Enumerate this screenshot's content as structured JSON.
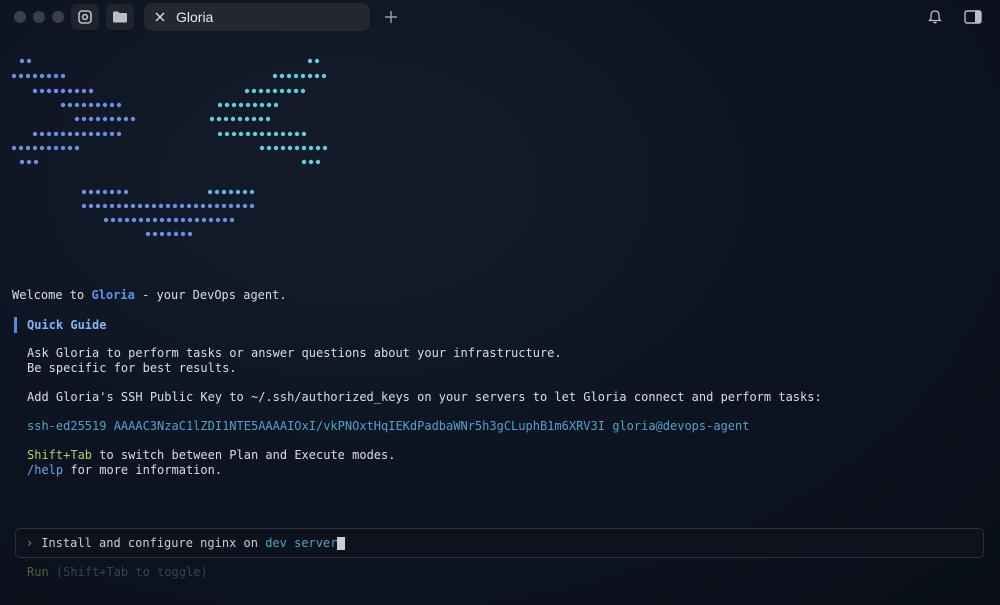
{
  "window": {
    "tab_title": "Gloria",
    "icons": [
      "gloria-logo-icon",
      "folder-icon",
      "close-icon",
      "plus-icon",
      "bell-icon",
      "sidebar-icon"
    ]
  },
  "welcome": {
    "prefix": "Welcome to ",
    "name": "Gloria",
    "suffix": " - your DevOps agent."
  },
  "guide": {
    "title": "Quick Guide",
    "line1": "Ask Gloria to perform tasks or answer questions about your infrastructure.",
    "line2": "Be specific for best results.",
    "line3": "Add Gloria's SSH Public Key to ~/.ssh/authorized_keys on your servers to let Gloria connect and perform tasks:",
    "ssh_key": "ssh-ed25519 AAAAC3NzaC1lZDI1NTE5AAAAIOxI/vkPNOxtHqIEKdPadbaWNr5h3gCLuphB1m6XRV3I gloria@devops-agent",
    "shortcut": "Shift+Tab",
    "shortcut_desc": " to switch between Plan and Execute modes.",
    "help_cmd": "/help",
    "help_desc": " for more information."
  },
  "prompt": {
    "marker": "›",
    "text": "Install and configure nginx on ",
    "highlight": "dev server"
  },
  "mode": {
    "label": "Run",
    "hint": " (Shift+Tab to toggle)"
  },
  "colors": {
    "accent_blue": "#5a96ea",
    "teal": "#4fa3c9",
    "green": "#a8d36a",
    "art_left": "#6c8fe6",
    "art_right": "#5ed0dc"
  }
}
